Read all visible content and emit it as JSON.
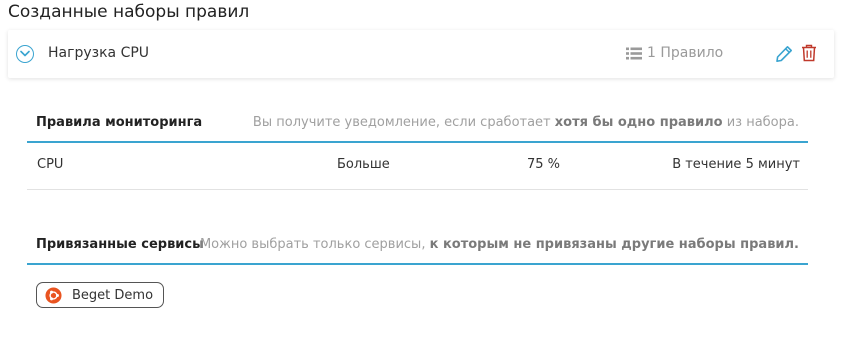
{
  "page_title": "Созданные наборы правил",
  "ruleset": {
    "name": "Нагрузка CPU",
    "rules_count": "1 Правило"
  },
  "monitoring": {
    "title": "Правила мониторинга",
    "hint_before": "Вы получите уведомление, если сработает ",
    "hint_bold": "хотя бы одно правило",
    "hint_after": " из набора."
  },
  "rules": [
    {
      "metric": "CPU",
      "condition": "Больше",
      "value": "75 %",
      "duration": "В течение 5 минут"
    }
  ],
  "services": {
    "title": "Привязанные сервисы",
    "hint_before": "Можно выбрать только сервисы, ",
    "hint_bold": "к которым не привязаны другие наборы правил."
  },
  "linked_services": [
    {
      "name": "Beget Demo",
      "icon": "ubuntu-icon"
    }
  ],
  "colors": {
    "accent": "#3aa4d0",
    "delete": "#c0392b",
    "ubuntu": "#e95420"
  }
}
